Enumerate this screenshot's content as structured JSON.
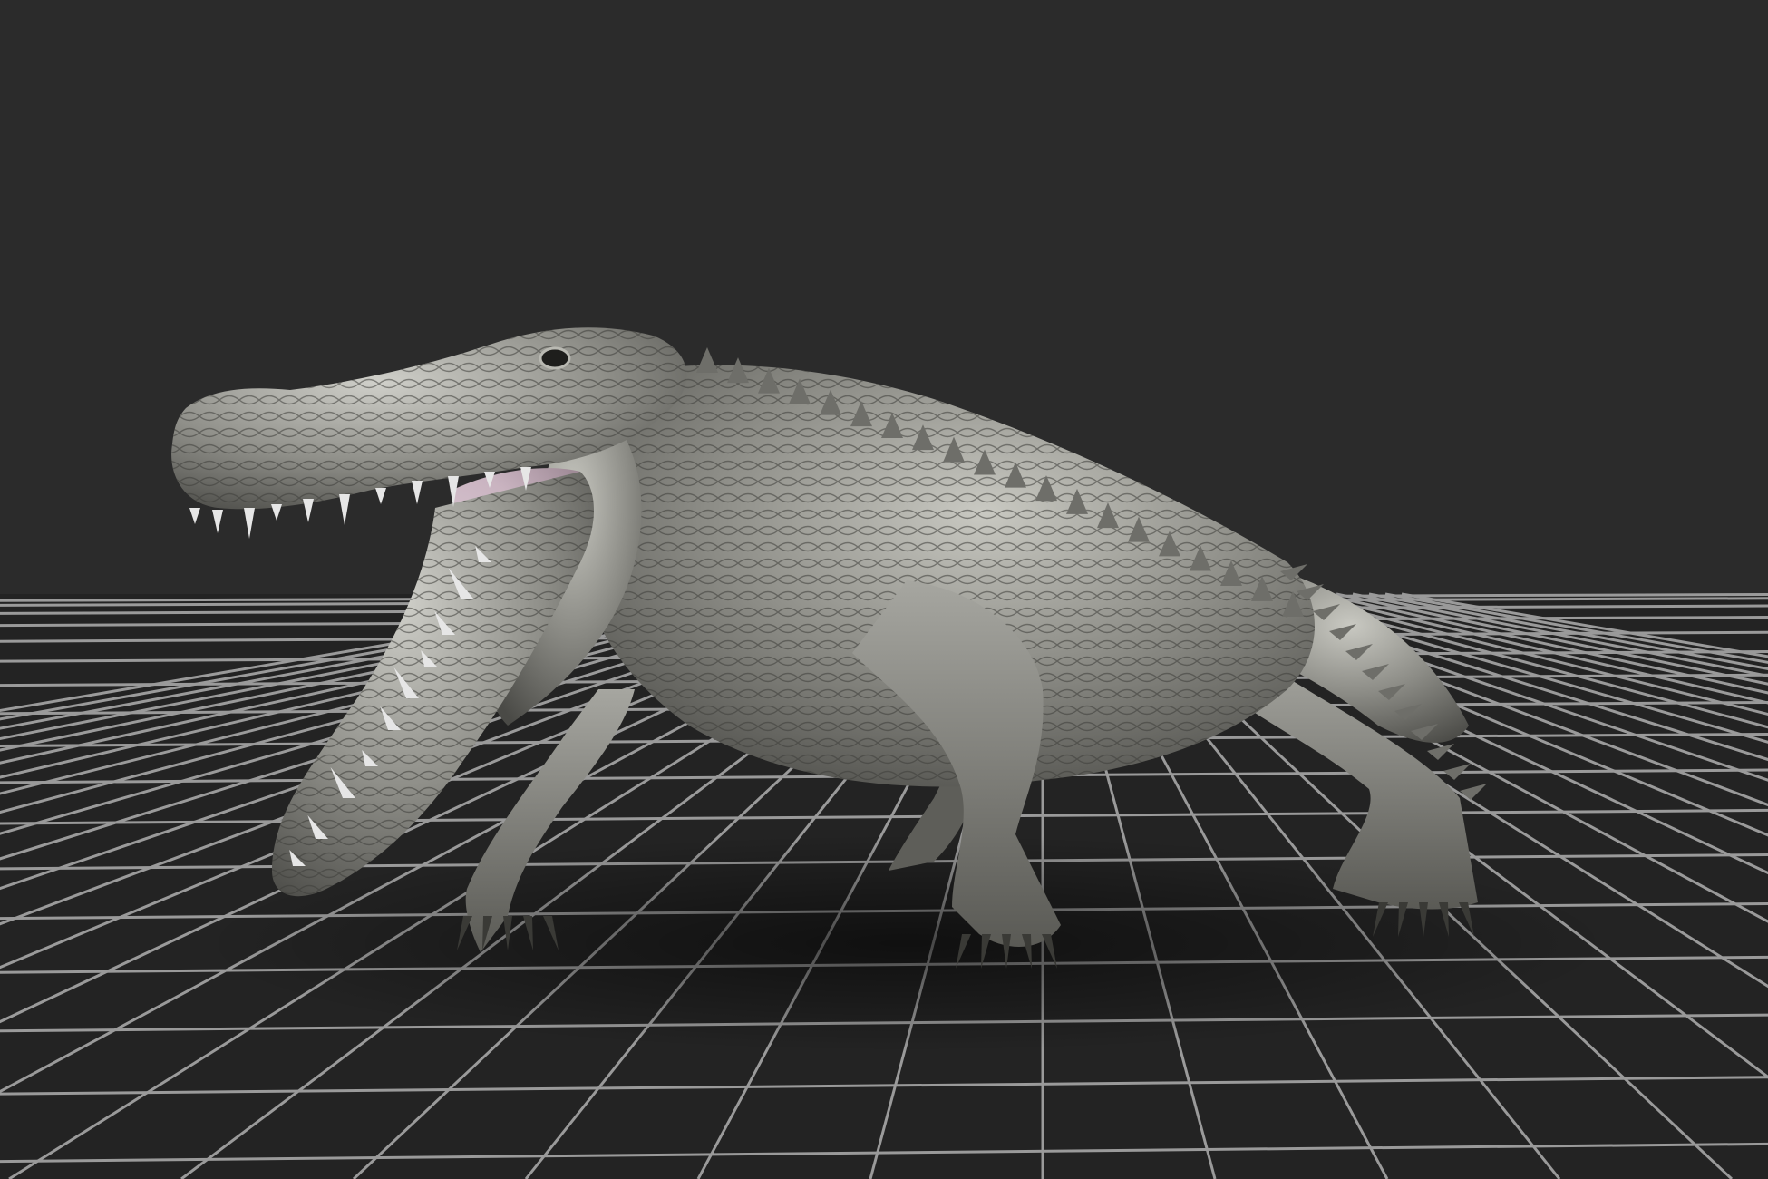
{
  "viewport": {
    "background_color": "#2b2b2b",
    "floor_color": "#1f1f1f",
    "grid_line_color": "#9a9a9a",
    "grid_visible": true
  },
  "model": {
    "subject": "crocodile",
    "pose": "mouth-open-walking",
    "skin_color": "#8c8c86",
    "skin_highlight_color": "#c9c9c2",
    "skin_shadow_color": "#4a4a46",
    "mouth_color": "#c9b3c0",
    "teeth_color": "#e6e6e6"
  }
}
